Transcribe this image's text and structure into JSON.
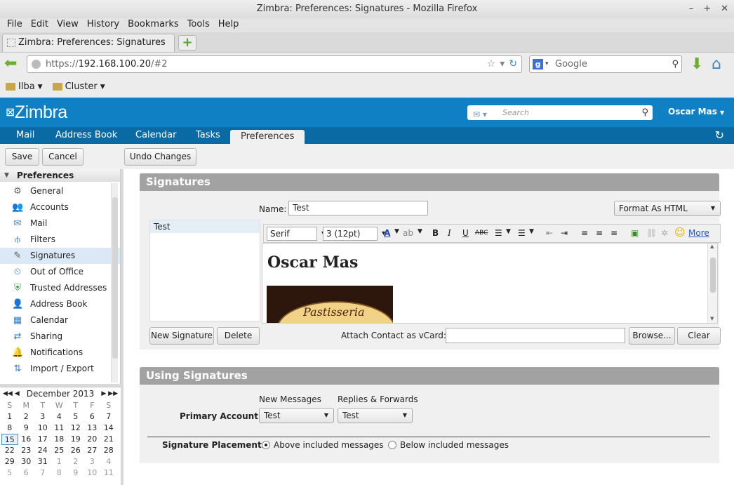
{
  "window": {
    "title": "Zimbra: Preferences: Signatures - Mozilla Firefox",
    "controls": [
      "–",
      "+",
      "✕"
    ]
  },
  "menu": [
    "File",
    "Edit",
    "View",
    "History",
    "Bookmarks",
    "Tools",
    "Help"
  ],
  "browser_tab": {
    "title": "Zimbra: Preferences: Signatures"
  },
  "url": {
    "prefix": "https://",
    "host": "192.168.100.20",
    "path": "/#2"
  },
  "search": {
    "engine": "Google"
  },
  "bookmarks": [
    "Ilba",
    "Cluster"
  ],
  "zimbra": {
    "logo": "Zimbra",
    "search_placeholder": "Search",
    "user": "Oscar Mas",
    "tabs": [
      "Mail",
      "Address Book",
      "Calendar",
      "Tasks",
      "Preferences"
    ]
  },
  "toolbar": {
    "save": "Save",
    "cancel": "Cancel",
    "undo": "Undo Changes"
  },
  "sidebar": {
    "header": "Preferences",
    "items": [
      "General",
      "Accounts",
      "Mail",
      "Filters",
      "Signatures",
      "Out of Office",
      "Trusted Addresses",
      "Address Book",
      "Calendar",
      "Sharing",
      "Notifications",
      "Import / Export"
    ],
    "icons": [
      "gear-icon",
      "accounts-icon",
      "mail-icon",
      "filters-icon",
      "signature-icon",
      "out-of-office-icon",
      "trusted-shield-icon",
      "address-book-icon",
      "calendar-icon",
      "sharing-icon",
      "bell-icon",
      "import-export-icon"
    ],
    "selected": "Signatures"
  },
  "calendar": {
    "month": "December 2013",
    "dow": [
      "S",
      "M",
      "T",
      "W",
      "T",
      "F",
      "S"
    ],
    "weeks": [
      [
        "1",
        "2",
        "3",
        "4",
        "5",
        "6",
        "7"
      ],
      [
        "8",
        "9",
        "10",
        "11",
        "12",
        "13",
        "14"
      ],
      [
        "15",
        "16",
        "17",
        "18",
        "19",
        "20",
        "21"
      ],
      [
        "22",
        "23",
        "24",
        "25",
        "26",
        "27",
        "28"
      ],
      [
        "29",
        "30",
        "31",
        "1",
        "2",
        "3",
        "4"
      ],
      [
        "5",
        "6",
        "7",
        "8",
        "9",
        "10",
        "11"
      ]
    ],
    "today": "15"
  },
  "signatures": {
    "header": "Signatures",
    "list": [
      "Test"
    ],
    "name_label": "Name:",
    "name_value": "Test",
    "format": "Format As HTML",
    "font": "Serif",
    "size": "3 (12pt)",
    "more": "More",
    "content_heading": "Oscar Mas",
    "image_text": "Pastisseria",
    "new_button": "New Signature",
    "delete_button": "Delete",
    "vcard_label": "Attach Contact as vCard:",
    "browse_button": "Browse...",
    "clear_button": "Clear"
  },
  "using": {
    "header": "Using Signatures",
    "new_messages": "New Messages",
    "replies": "Replies & Forwards",
    "primary_label": "Primary Account:",
    "new_value": "Test",
    "reply_value": "Test",
    "placement_label": "Signature Placement:",
    "above": "Above included messages",
    "below": "Below included messages"
  }
}
